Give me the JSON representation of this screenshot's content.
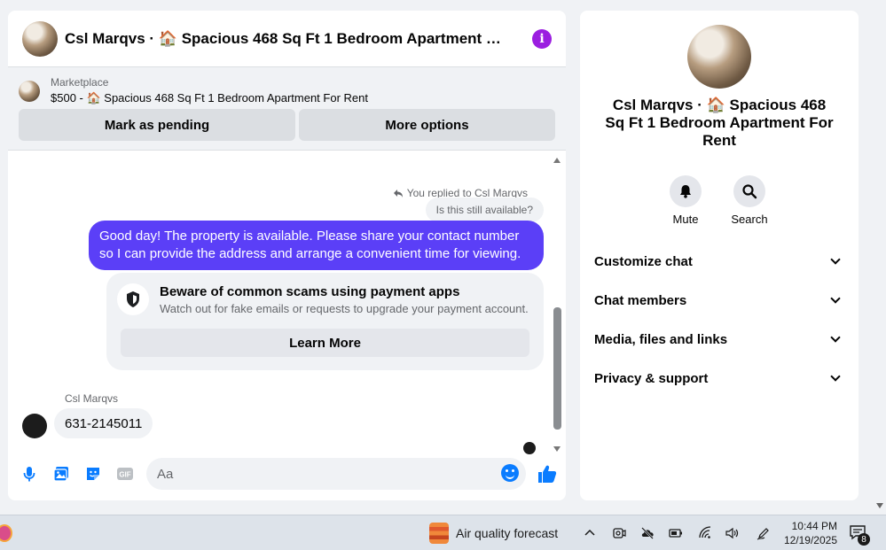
{
  "header": {
    "title": "Csl Marqvs · 🏠 Spacious 468 Sq Ft 1 Bedroom Apartment For Rent",
    "info_icon": "info-icon"
  },
  "marketplace": {
    "label": "Marketplace",
    "item": "$500 - 🏠 Spacious 468 Sq Ft 1 Bedroom Apartment For Rent",
    "mark_pending_label": "Mark as pending",
    "more_options_label": "More options"
  },
  "thread": {
    "replied_label": "You replied to Csl Marqvs",
    "quoted_message": "Is this still available?",
    "sent_message": "Good day! The property is available. Please share your contact number so I can provide the address and arrange a convenient time for viewing.",
    "scam_title": "Beware of common scams using payment apps",
    "scam_desc": "Watch out for fake emails or requests to upgrade your payment account.",
    "learn_more_label": "Learn More",
    "sender_name": "Csl Marqvs",
    "received_message": "631-2145011"
  },
  "composer": {
    "placeholder": "Aa",
    "icons": [
      "microphone-icon",
      "photo-icon",
      "sticker-icon",
      "gif-icon",
      "emoji-icon",
      "thumbs-up-icon"
    ]
  },
  "sidebar": {
    "title": "Csl Marqvs · 🏠 Spacious 468 Sq Ft 1 Bedroom Apartment For Rent",
    "actions": [
      {
        "label": "Mute",
        "icon": "bell-icon"
      },
      {
        "label": "Search",
        "icon": "search-icon"
      }
    ],
    "sections": [
      {
        "label": "Customize chat"
      },
      {
        "label": "Chat members"
      },
      {
        "label": "Media, files and links"
      },
      {
        "label": "Privacy & support"
      }
    ]
  },
  "taskbar": {
    "weather_label": "Air quality forecast",
    "time": "10:44 PM",
    "date": "12/19/2025",
    "notification_count": "8"
  },
  "colors": {
    "accent_purple": "#5b3ff7",
    "info_purple": "#9b1ee0",
    "composer_blue": "#0a7cff"
  }
}
